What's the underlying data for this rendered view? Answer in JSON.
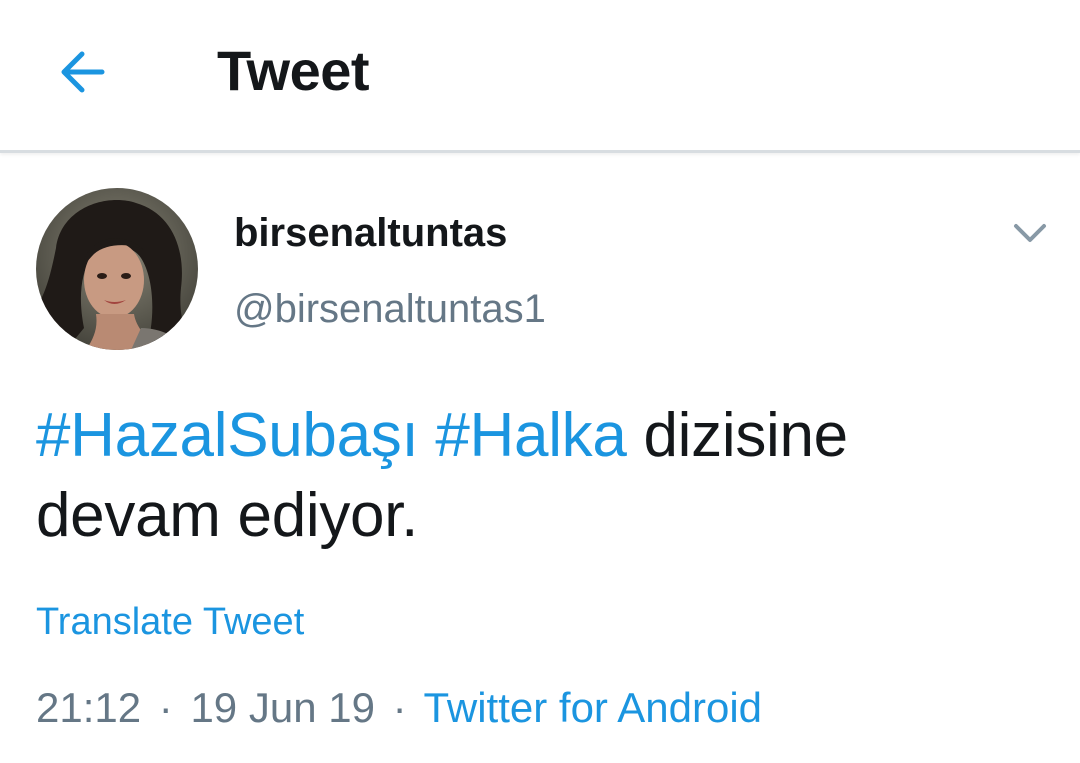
{
  "header": {
    "title": "Tweet",
    "back_icon": "arrow-left-icon",
    "accent_color": "#1b95e0"
  },
  "tweet": {
    "author": {
      "display_name": "birsenaltuntas",
      "handle": "@birsenaltuntas1",
      "avatar": "profile-photo"
    },
    "menu_icon": "chevron-down-icon",
    "text": {
      "hashtag_1": "#HazalSubaşı",
      "hashtag_2": "#Halka",
      "line_rest": "dizisine",
      "line_2": "devam ediyor."
    },
    "translate_label": "Translate Tweet",
    "meta": {
      "time": "21:12",
      "separator": "·",
      "date": "19 Jun 19",
      "source": "Twitter for Android"
    }
  }
}
